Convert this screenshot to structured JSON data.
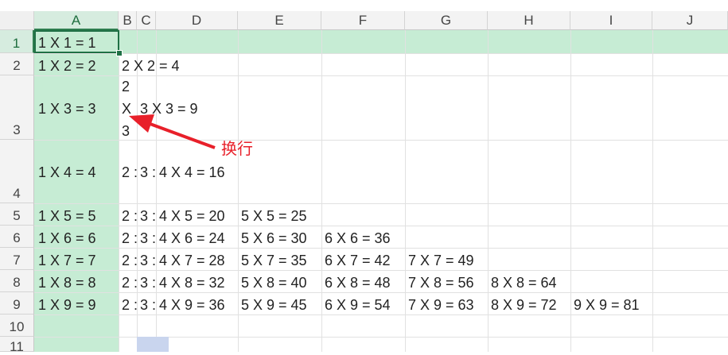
{
  "columns": [
    "A",
    "B",
    "C",
    "D",
    "E",
    "F",
    "G",
    "H",
    "I",
    "J"
  ],
  "rows": [
    "1",
    "2",
    "3",
    "4",
    "5",
    "6",
    "7",
    "8",
    "9",
    "10",
    "11"
  ],
  "cells": {
    "r1": [
      "1 X 1 = 1"
    ],
    "r2": [
      "1 X 2 = 2",
      "2 X 2 = 4"
    ],
    "r3": {
      "a": "1 X 3 = 3",
      "b_lines": [
        "2",
        "X",
        "3"
      ],
      "c": "3 X 3 = 9"
    },
    "r4": [
      "1 X 4 = 4",
      "2 :",
      "3 :",
      "4 X 4 = 16"
    ],
    "r5": [
      "1 X 5 = 5",
      "2 :",
      "3 :",
      "4 X 5 = 20",
      "5 X 5 = 25"
    ],
    "r6": [
      "1 X 6 = 6",
      "2 :",
      "3 :",
      "4 X 6 = 24",
      "5 X 6 = 30",
      "6 X 6 = 36"
    ],
    "r7": [
      "1 X 7 = 7",
      "2 :",
      "3 :",
      "4 X 7 = 28",
      "5 X 7 = 35",
      "6 X 7 = 42",
      "7 X 7 = 49"
    ],
    "r8": [
      "1 X 8 = 8",
      "2 :",
      "3 :",
      "4 X 8 = 32",
      "5 X 8 = 40",
      "6 X 8 = 48",
      "7 X 8 = 56",
      "8 X 8 = 64"
    ],
    "r9": [
      "1 X 9 = 9",
      "2 :",
      "3 :",
      "4 X 9 = 36",
      "5 X 9 = 45",
      "6 X 9 = 54",
      "7 X 9 = 63",
      "8 X 9 = 72",
      "9 X 9 = 81"
    ]
  },
  "annotation": {
    "text": "换行",
    "color": "#e8202a"
  },
  "colors": {
    "selection": "#c6ecd4",
    "active_border": "#1f7045",
    "grid": "#e1e1e1"
  }
}
